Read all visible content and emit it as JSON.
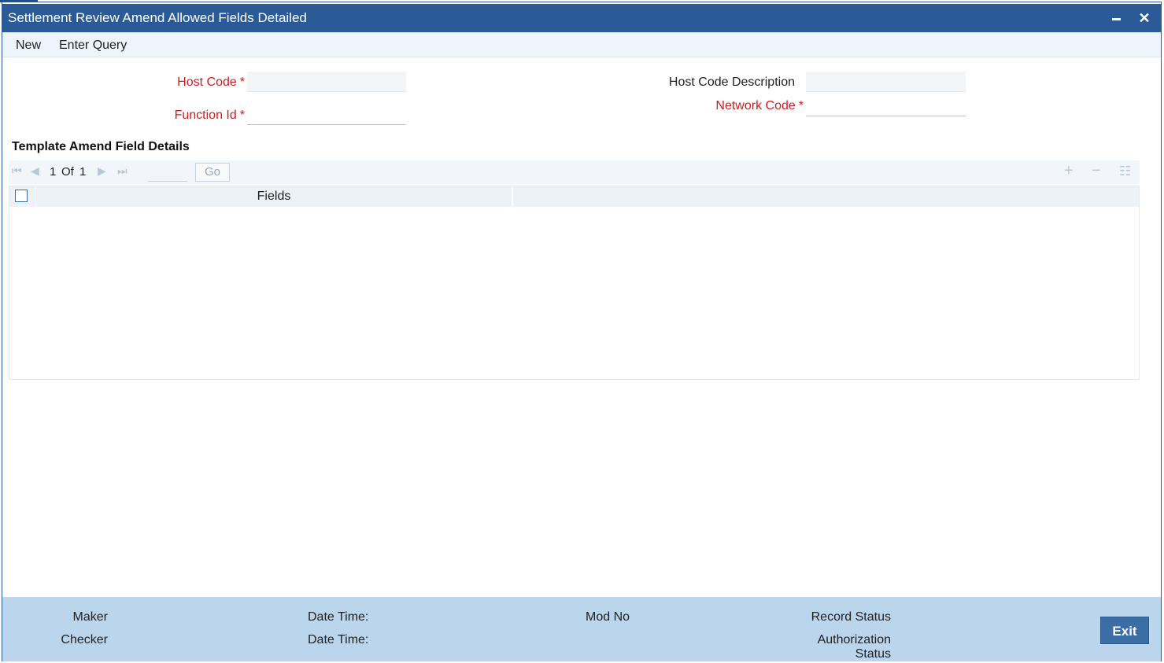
{
  "window": {
    "title": "Settlement Review Amend Allowed Fields Detailed",
    "minimize_icon": "minimize-icon",
    "close_icon": "close-icon"
  },
  "menu": {
    "new_label": "New",
    "enter_query_label": "Enter Query"
  },
  "form": {
    "host_code_label": "Host Code",
    "host_code_value": "",
    "host_code_description_label": "Host Code Description",
    "host_code_description_value": "",
    "function_id_label": "Function Id",
    "function_id_value": "",
    "network_code_label": "Network Code",
    "network_code_value": "",
    "required_marker": "*"
  },
  "section": {
    "title": "Template Amend Field Details"
  },
  "pagination": {
    "current": "1",
    "of_label": "Of",
    "total": "1",
    "page_value": "",
    "go_label": "Go"
  },
  "grid": {
    "columns": [
      "Fields"
    ],
    "rows": []
  },
  "footer": {
    "maker_label": "Maker",
    "checker_label": "Checker",
    "date_time_label_1": "Date Time:",
    "date_time_label_2": "Date Time:",
    "mod_no_label": "Mod No",
    "record_status_label": "Record Status",
    "authorization_label_line1": "Authorization",
    "authorization_label_line2": "Status",
    "exit_label": "Exit"
  },
  "colors": {
    "titlebar": "#2b5b96",
    "required": "#d11c1c",
    "footer": "#bad5ec",
    "exit_button": "#3a6ea5"
  }
}
